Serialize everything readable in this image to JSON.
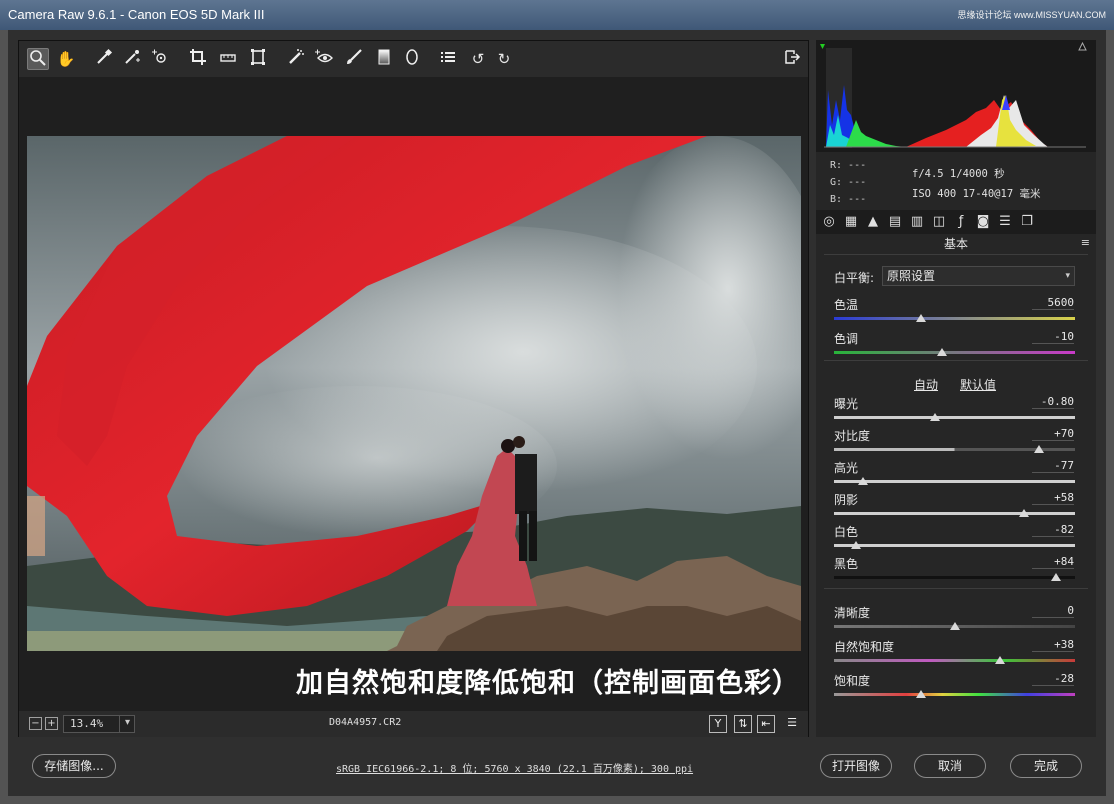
{
  "window": {
    "title": "Camera Raw 9.6.1 -  Canon EOS 5D Mark III",
    "watermark": "思缘设计论坛 www.MISSYUAN.COM"
  },
  "toolbar": {
    "tools": [
      "zoom-icon",
      "hand-icon",
      "white-balance-icon",
      "color-sampler-icon",
      "targeted-adjust-icon",
      "crop-icon",
      "straighten-icon",
      "transform-icon",
      "spot-removal-icon",
      "red-eye-icon",
      "adjustment-brush-icon",
      "graduated-filter-icon",
      "radial-filter-icon",
      "preferences-icon",
      "rotate-left-icon",
      "rotate-right-icon"
    ],
    "export_icon": "toggle-fullscreen-icon"
  },
  "image": {
    "caption": "加自然饱和度降低饱和（控制画面色彩）"
  },
  "status": {
    "zoom_minus": "−",
    "zoom_plus": "+",
    "zoom_level": "13.4%",
    "filename": "D04A4957.CR2"
  },
  "info": {
    "r": "R:  ---",
    "g": "G:  ---",
    "b": "B:  ---",
    "exposure_line": "f/4.5  1/4000 秒",
    "iso_line": "ISO 400  17-40@17 毫米"
  },
  "panel": {
    "title": "基本",
    "white_balance_label": "白平衡:",
    "white_balance_value": "原照设置",
    "auto_link": "自动",
    "default_link": "默认值",
    "sliders": [
      {
        "label": "色温",
        "value": "5600",
        "pos": 0.36
      },
      {
        "label": "色调",
        "value": "-10",
        "pos": 0.45
      },
      {
        "label": "曝光",
        "value": "-0.80",
        "pos": 0.42
      },
      {
        "label": "对比度",
        "value": "+70",
        "pos": 0.85
      },
      {
        "label": "高光",
        "value": "-77",
        "pos": 0.12
      },
      {
        "label": "阴影",
        "value": "+58",
        "pos": 0.79
      },
      {
        "label": "白色",
        "value": "-82",
        "pos": 0.09
      },
      {
        "label": "黑色",
        "value": "+84",
        "pos": 0.92
      },
      {
        "label": "清晰度",
        "value": "0",
        "pos": 0.5
      },
      {
        "label": "自然饱和度",
        "value": "+38",
        "pos": 0.69
      },
      {
        "label": "饱和度",
        "value": "-28",
        "pos": 0.36
      }
    ]
  },
  "bottom": {
    "save_button": "存储图像...",
    "output_info": "sRGB IEC61966-2.1; 8 位; 5760 x 3840 (22.1 百万像素); 300 ppi",
    "open_button": "打开图像",
    "cancel_button": "取消",
    "done_button": "完成"
  }
}
